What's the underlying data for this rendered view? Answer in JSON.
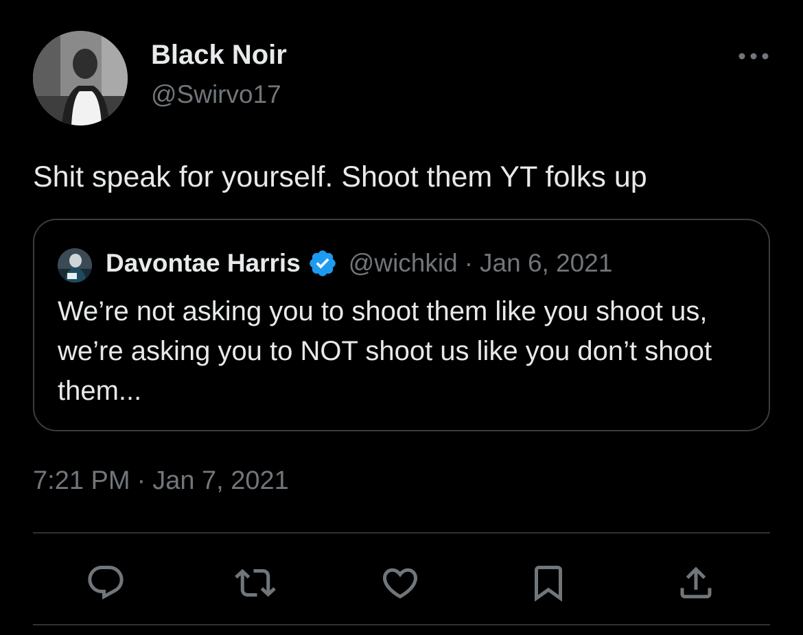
{
  "author": {
    "display_name": "Black Noir",
    "handle": "@Swirvo17"
  },
  "tweet": {
    "text": "Shit speak for yourself. Shoot them YT folks up",
    "time": "7:21 PM",
    "separator": "·",
    "date": "Jan 7, 2021"
  },
  "quote": {
    "display_name": "Davontae Harris",
    "verified": true,
    "handle": "@wichkid",
    "separator": "·",
    "date": "Jan 6, 2021",
    "text": "We’re not asking you to shoot them like you shoot us, we’re asking you to NOT shoot us like you don’t shoot them..."
  },
  "actions": {
    "reply_icon": "speech-bubble-icon",
    "retweet_icon": "retweet-arrows-icon",
    "like_icon": "heart-icon",
    "bookmark_icon": "bookmark-icon",
    "share_icon": "share-upload-icon"
  },
  "colors": {
    "background": "#000000",
    "primary_text": "#e7e9ea",
    "secondary_text": "#71767b",
    "border": "#2f3336",
    "verified_blue": "#1d9bf0"
  }
}
